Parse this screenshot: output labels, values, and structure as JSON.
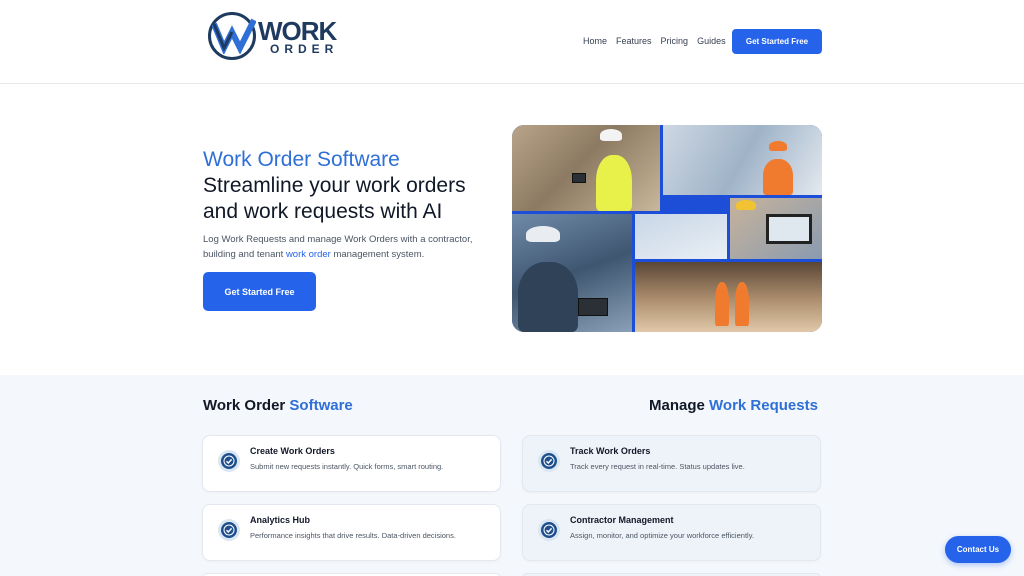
{
  "brand": {
    "word1": "WORK",
    "word2": "ORDER",
    "icon": "w-check-logo"
  },
  "nav": {
    "items": [
      "Home",
      "Features",
      "Pricing",
      "Guides"
    ],
    "cta": "Get Started Free"
  },
  "hero": {
    "kicker": "Work Order Software",
    "title": "Streamline your work orders and work requests with AI",
    "desc_part1": "Log Work Requests and manage Work Orders with a contractor, building and tenant ",
    "desc_link": "work order",
    "desc_part2": " management system.",
    "cta": "Get Started Free"
  },
  "sections": {
    "left_title": "Work Order ",
    "left_accent": "Software",
    "right_title": "Manage ",
    "right_accent": "Work Requests"
  },
  "cards_left": [
    {
      "title": "Create Work Orders",
      "desc": "Submit new requests instantly. Quick forms, smart routing."
    },
    {
      "title": "Analytics Hub",
      "desc": "Performance insights that drive results. Data-driven decisions."
    }
  ],
  "cards_right": [
    {
      "title": "Track Work Orders",
      "desc": "Track every request in real-time. Status updates live."
    },
    {
      "title": "Contractor Management",
      "desc": "Assign, monitor, and optimize your workforce efficiently."
    }
  ],
  "contact": {
    "label": "Contact Us"
  },
  "colors": {
    "primary": "#2563eb",
    "accent_text": "#2f6fd6",
    "navy": "#1e3a5f",
    "band_bg": "#f4f7fb"
  }
}
